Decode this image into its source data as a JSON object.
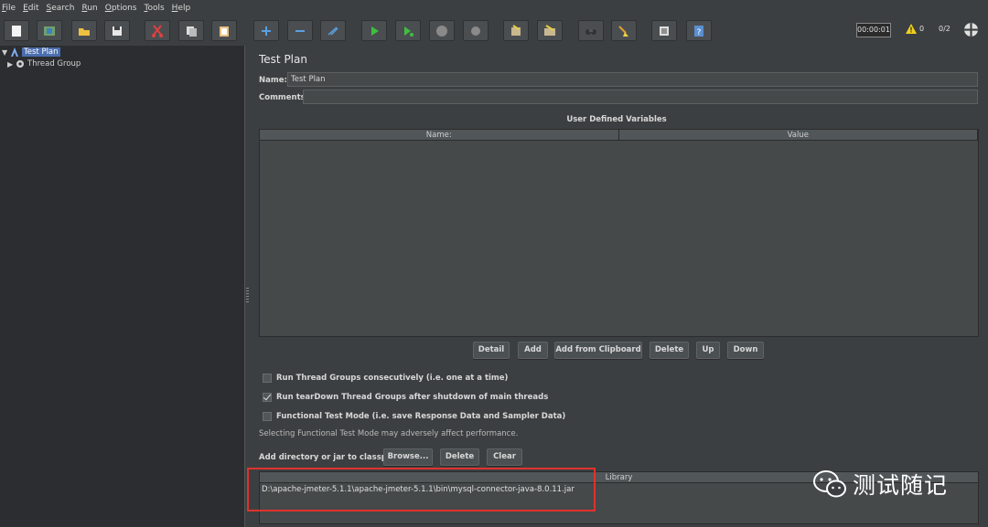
{
  "menu": [
    "File",
    "Edit",
    "Search",
    "Run",
    "Options",
    "Tools",
    "Help"
  ],
  "toolbar": {
    "buttons": [
      "new",
      "templates",
      "open",
      "save",
      "cut",
      "copy",
      "paste",
      "expand",
      "collapse",
      "toggle",
      "start",
      "start-no-pause",
      "stop",
      "shutdown",
      "clear",
      "clear-all",
      "search",
      "reset-search",
      "function-helper",
      "help"
    ],
    "timer": "00:00:01",
    "warnings": "0",
    "threads": "0/2"
  },
  "tree": {
    "nodes": [
      {
        "label": "Test Plan",
        "selected": true
      },
      {
        "label": "Thread Group",
        "selected": false
      }
    ]
  },
  "main": {
    "title": "Test Plan",
    "name_label": "Name:",
    "name_value": "Test Plan",
    "comments_label": "Comments:",
    "comments_value": "",
    "udv": {
      "title": "User Defined Variables",
      "columns": [
        "Name:",
        "Value"
      ],
      "rows": []
    },
    "udv_buttons": [
      "Detail",
      "Add",
      "Add from Clipboard",
      "Delete",
      "Up",
      "Down"
    ],
    "options": [
      {
        "label": "Run Thread Groups consecutively (i.e. one at a time)",
        "checked": false
      },
      {
        "label": "Run tearDown Thread Groups after shutdown of main threads",
        "checked": true
      },
      {
        "label": "Functional Test Mode (i.e. save Response Data and Sampler Data)",
        "checked": false
      }
    ],
    "perf_note": "Selecting Functional Test Mode may adversely affect performance.",
    "classpath_label": "Add directory or jar to classpath",
    "classpath_buttons": [
      "Browse...",
      "Delete",
      "Clear"
    ],
    "library": {
      "column": "Library",
      "rows": [
        "D:\\apache-jmeter-5.1.1\\apache-jmeter-5.1.1\\bin\\mysql-connector-java-8.0.11.jar"
      ]
    }
  },
  "watermark": "测试随记",
  "colors": {
    "background": "#3c3f41",
    "tree_background": "#2b2d30",
    "selection": "#4b6eaf",
    "highlight": "#e0322d"
  }
}
